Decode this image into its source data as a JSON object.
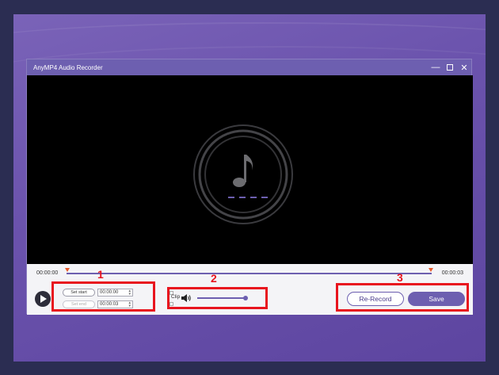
{
  "window": {
    "title": "AnyMP4 Audio Recorder",
    "minimize_icon": "minimize-icon",
    "maximize_icon": "maximize-icon",
    "close_icon": "close-icon"
  },
  "player": {
    "music_icon": "music-note-icon",
    "placeholder_dashes": "- - - -",
    "time_start": "00:00:00",
    "time_end": "00:00:03"
  },
  "clip": {
    "set_start_label": "Set start",
    "set_end_label": "Set end",
    "start_value": "00:00:00",
    "end_value": "00:00:03",
    "clip_label": "Clip"
  },
  "volume": {
    "icon": "speaker-icon",
    "level": 1.0
  },
  "actions": {
    "rerecord_label": "Re-Record",
    "save_label": "Save"
  },
  "annotations": [
    "1",
    "2",
    "3"
  ],
  "colors": {
    "accent": "#6d5fb0",
    "annotation": "#e8141e",
    "marker": "#e8592a"
  }
}
